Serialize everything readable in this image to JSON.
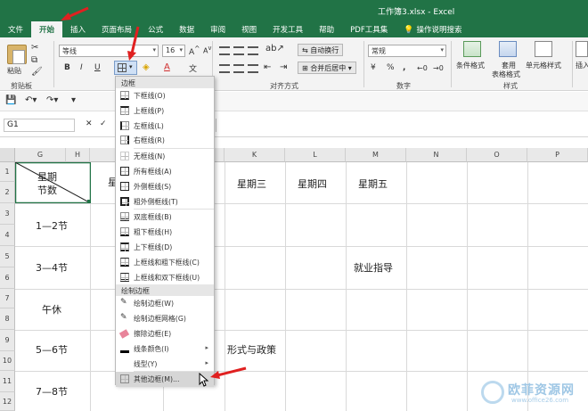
{
  "window": {
    "title": "工作簿3.xlsx  -  Excel"
  },
  "tabs": [
    "文件",
    "开始",
    "插入",
    "页面布局",
    "公式",
    "数据",
    "审阅",
    "视图",
    "开发工具",
    "帮助",
    "PDF工具集",
    "操作说明搜索"
  ],
  "ribbon": {
    "paste_label": "粘贴",
    "clipboard_label": "剪贴板",
    "font_name": "等线",
    "font_size": "16",
    "bold": "B",
    "italic": "I",
    "underline": "U",
    "wrap_text": "自动换行",
    "merge_center": "合并后居中",
    "alignment_label": "对齐方式",
    "number_format": "常规",
    "number_label": "数字",
    "cond_format": "条件格式",
    "table_format_1": "套用",
    "table_format_2": "表格格式",
    "cell_style": "单元格样式",
    "style_label": "样式",
    "insert_label": "插入",
    "percent": "%",
    "comma": ","
  },
  "formula_bar": {
    "name_box": "G1"
  },
  "columns": [
    "G",
    "H",
    "K",
    "L",
    "M",
    "N",
    "O",
    "P"
  ],
  "rows": [
    "1",
    "2",
    "3",
    "4",
    "5",
    "6",
    "7",
    "8",
    "9",
    "10",
    "11",
    "12"
  ],
  "cells": {
    "header_top": "星期",
    "header_bottom": "节数",
    "partial": "星",
    "wed": "星期三",
    "thu": "星期四",
    "fri": "星期五",
    "p12": "1—2节",
    "p34": "3—4节",
    "noon": "午休",
    "p56": "5—6节",
    "p78": "7—8节",
    "career": "就业指导",
    "policy": "形式与政策"
  },
  "border_menu": {
    "section_borders": "边框",
    "items": [
      "下框线(O)",
      "上框线(P)",
      "左框线(L)",
      "右框线(R)",
      "无框线(N)",
      "所有框线(A)",
      "外侧框线(S)",
      "粗外侧框线(T)",
      "双底框线(B)",
      "粗下框线(H)",
      "上下框线(D)",
      "上框线和粗下框线(C)",
      "上框线和双下框线(U)"
    ],
    "section_draw": "绘制边框",
    "draw_items": [
      "绘制边框(W)",
      "绘制边框网格(G)",
      "擦除边框(E)",
      "线条颜色(I)",
      "线型(Y)"
    ],
    "more": "其他边框(M)..."
  },
  "watermark": {
    "name": "欧菲资源网",
    "url": "www.office26.com"
  },
  "colors": {
    "excel_green": "#217346",
    "annotation_red": "#e02020"
  }
}
